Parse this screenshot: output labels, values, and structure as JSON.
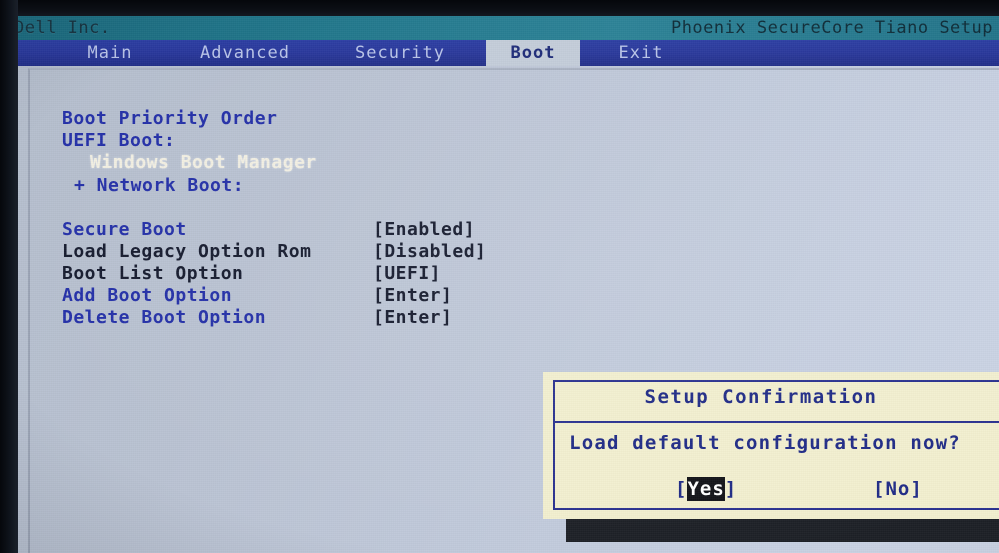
{
  "titlebar": {
    "vendor": "Dell Inc.",
    "product": "Phoenix SecureCore Tiano Setup"
  },
  "menu": {
    "tabs": [
      {
        "label": "Main",
        "active": false
      },
      {
        "label": "Advanced",
        "active": false
      },
      {
        "label": "Security",
        "active": false
      },
      {
        "label": "Boot",
        "active": true
      },
      {
        "label": "Exit",
        "active": false
      }
    ]
  },
  "boot_priority": {
    "heading": "Boot Priority Order",
    "groups": [
      {
        "label": "UEFI Boot:",
        "expander": ""
      },
      {
        "label": "Windows Boot Manager",
        "expander": ""
      },
      {
        "label": "Network Boot:",
        "expander": "+"
      }
    ],
    "uefi_boot_label": "UEFI Boot:",
    "windows_boot_manager": "Windows Boot Manager",
    "network_boot_label": "+ Network Boot:"
  },
  "settings": {
    "rows": [
      {
        "label": "Secure Boot",
        "value": "[Enabled]"
      },
      {
        "label": "Load Legacy Option Rom",
        "value": "[Disabled]"
      },
      {
        "label": "Boot List Option",
        "value": "[UEFI]"
      },
      {
        "label": "Add Boot Option",
        "value": "[Enter]"
      },
      {
        "label": "Delete Boot Option",
        "value": "[Enter]"
      }
    ]
  },
  "dialog": {
    "title": "Setup Confirmation",
    "message": "Load default configuration now?",
    "buttons": {
      "yes_open": "[",
      "yes_text": "Yes",
      "yes_close": "]",
      "no": "[No]"
    },
    "selected_button": "Yes"
  },
  "colors": {
    "titlebar_teal": "#22788c",
    "menubar_blue": "#29389b",
    "active_tab_bg": "#c3ccd9",
    "body_bg": "#bdc6d6",
    "label_blue": "#2430a8",
    "label_dark": "#161b2e",
    "highlight_white": "#f2efe2",
    "dialog_bg": "#f2efcf",
    "dialog_border": "#29318f",
    "selection_bg": "#121318"
  }
}
